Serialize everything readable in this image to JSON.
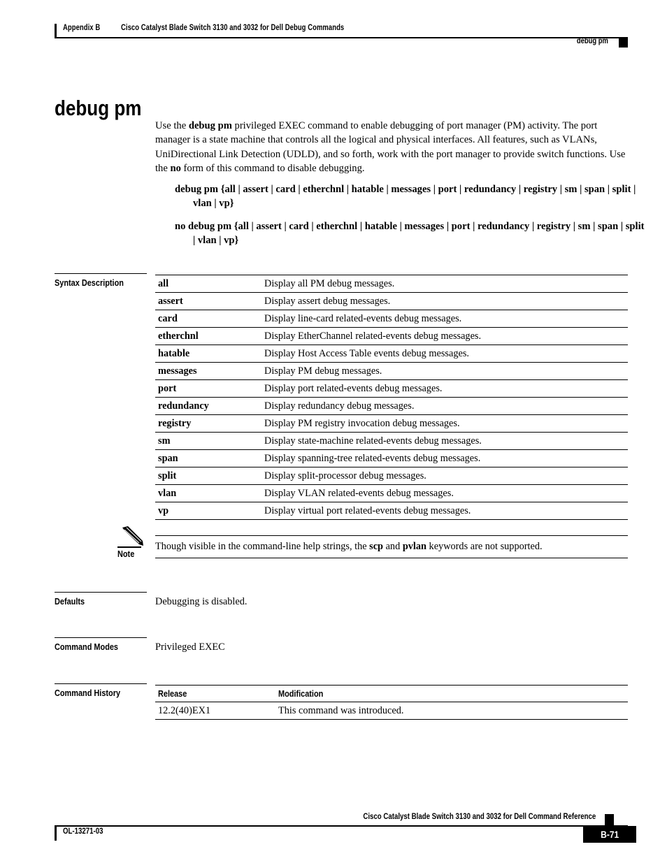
{
  "header": {
    "appendix": "Appendix B",
    "chapter_title": "Cisco Catalyst Blade Switch 3130 and 3032 for Dell Debug Commands",
    "command_name": "debug pm"
  },
  "command": {
    "title": "debug pm",
    "intro": "Use the debug pm privileged EXEC command to enable debugging of port manager (PM) activity. The port manager is a state machine that controls all the logical and physical interfaces. All features, such as VLANs, UniDirectional Link Detection (UDLD), and so forth, work with the port manager to provide switch functions. Use the no form of this command to disable debugging.",
    "syntax_positive": "debug pm {all | assert | card | etherchnl | hatable | messages | port | redundancy | registry | sm | span | split | vlan | vp}",
    "syntax_negative": "no debug pm {all | assert | card | etherchnl | hatable | messages | port | redundancy | registry | sm | span | split | vlan | vp}"
  },
  "sections": {
    "syntax_description": "Syntax Description",
    "defaults": "Defaults",
    "command_modes": "Command Modes",
    "command_history": "Command History"
  },
  "syntax_description_rows": [
    {
      "keyword": "all",
      "description": "Display all PM debug messages."
    },
    {
      "keyword": "assert",
      "description": "Display assert debug messages."
    },
    {
      "keyword": "card",
      "description": "Display line-card related-events debug messages."
    },
    {
      "keyword": "etherchnl",
      "description": "Display EtherChannel related-events debug messages."
    },
    {
      "keyword": "hatable",
      "description": "Display Host Access Table events debug messages."
    },
    {
      "keyword": "messages",
      "description": "Display PM debug messages."
    },
    {
      "keyword": "port",
      "description": "Display port related-events debug messages."
    },
    {
      "keyword": "redundancy",
      "description": "Display redundancy debug messages."
    },
    {
      "keyword": "registry",
      "description": "Display PM registry invocation debug messages."
    },
    {
      "keyword": "sm",
      "description": "Display state-machine related-events debug messages."
    },
    {
      "keyword": "span",
      "description": "Display spanning-tree related-events debug messages."
    },
    {
      "keyword": "split",
      "description": "Display split-processor debug messages."
    },
    {
      "keyword": "vlan",
      "description": "Display VLAN related-events debug messages."
    },
    {
      "keyword": "vp",
      "description": "Display virtual port related-events debug messages."
    }
  ],
  "note": {
    "label": "Note",
    "icon": "pencil-icon",
    "text": "Though visible in the command-line help strings, the scp and pvlan keywords are not supported."
  },
  "defaults_body": "Debugging is disabled.",
  "command_modes_body": "Privileged EXEC",
  "command_history": {
    "columns": [
      "Release",
      "Modification"
    ],
    "rows": [
      {
        "release": "12.2(40)EX1",
        "modification": "This command was introduced."
      }
    ]
  },
  "footer": {
    "doc_id": "OL-13271-03",
    "book_name": "Cisco Catalyst Blade Switch 3130 and 3032 for Dell Command Reference",
    "page_number": "B-71"
  }
}
